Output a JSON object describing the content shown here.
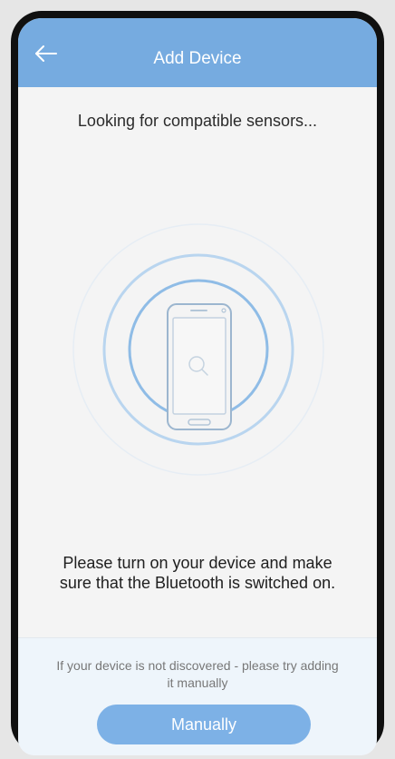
{
  "header": {
    "title": "Add Device",
    "back_icon": "arrow-left-icon"
  },
  "main": {
    "status_title": "Looking for compatible sensors...",
    "illustration_icons": [
      "phone-icon",
      "search-icon"
    ],
    "instructions": "Please turn on your device and make sure that the Bluetooth is switched on."
  },
  "footer": {
    "hint": "If your device is not discovered - please try adding it manually",
    "button_label": "Manually"
  },
  "colors": {
    "header_bg": "#76abe0",
    "button_bg": "#7db1e6",
    "screen_bg": "#f4f4f4",
    "footer_bg": "#eef5fb"
  }
}
